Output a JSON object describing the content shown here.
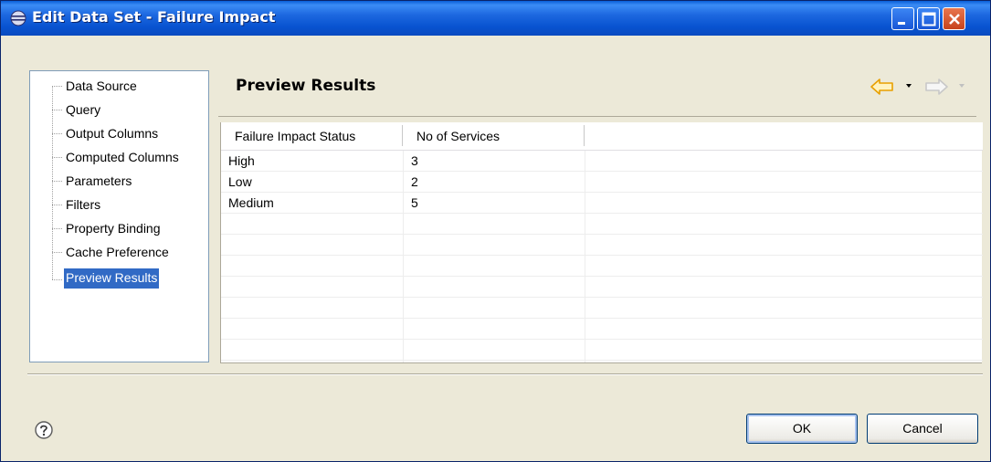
{
  "window": {
    "title": "Edit Data Set - Failure Impact"
  },
  "nav": {
    "items": [
      {
        "label": "Data Source"
      },
      {
        "label": "Query"
      },
      {
        "label": "Output Columns"
      },
      {
        "label": "Computed Columns"
      },
      {
        "label": "Parameters"
      },
      {
        "label": "Filters"
      },
      {
        "label": "Property Binding"
      },
      {
        "label": "Cache Preference"
      },
      {
        "label": "Preview Results",
        "selected": true
      }
    ]
  },
  "page": {
    "title": "Preview Results"
  },
  "table": {
    "columns": [
      "Failure Impact Status",
      "No of Services"
    ],
    "rows": [
      [
        "High",
        "3"
      ],
      [
        "Low",
        "2"
      ],
      [
        "Medium",
        "5"
      ]
    ]
  },
  "buttons": {
    "ok": "OK",
    "cancel": "Cancel"
  },
  "colors": {
    "titlebar": "#0853d0",
    "selection": "#316ac5",
    "dialog": "#ece9d8",
    "nav_arrow_active": "#e8a000",
    "nav_arrow_disabled": "#c8c8c8"
  },
  "icons": {
    "title": "eclipse-icon",
    "back": "back-arrow-icon",
    "forward": "forward-arrow-icon",
    "help": "help-icon"
  }
}
